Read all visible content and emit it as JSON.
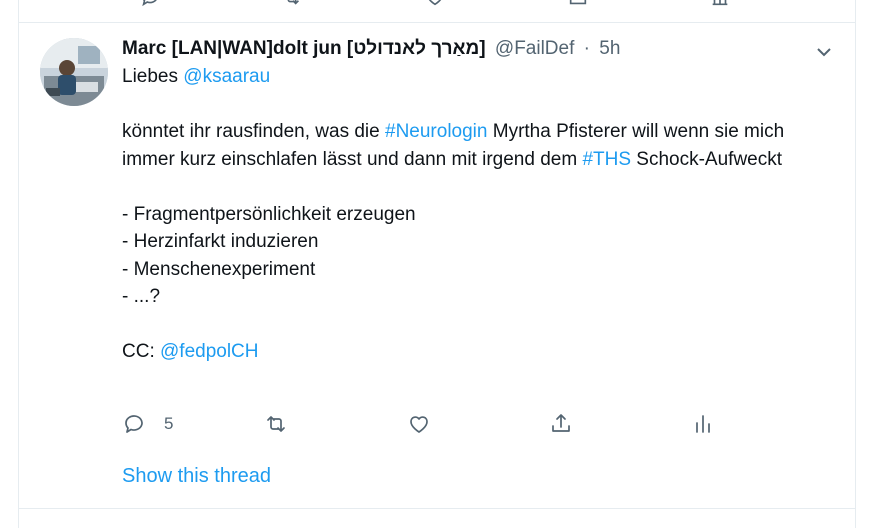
{
  "previous_tweet": {
    "icons": [
      "reply-icon",
      "retweet-icon",
      "like-icon",
      "share-icon",
      "analytics-icon"
    ]
  },
  "tweet": {
    "author_name": "Marc [LAN|WAN]dolt jun [מאַרך לאנדולט]",
    "author_handle": "@FailDef",
    "separator": "·",
    "time": "5h",
    "body": {
      "greeting": "Liebes ",
      "mention_1": "@ksaarau",
      "p2_a": "könntet ihr rausfinden, was die ",
      "hashtag_1": "#Neurologin",
      "p2_b": " Myrtha Pfisterer will wenn sie mich immer kurz einschlafen lässt und dann mit irgend dem ",
      "hashtag_2": "#THS",
      "p2_c": " Schock-Aufweckt",
      "list": [
        "- Fragmentpersönlichkeit erzeugen",
        "- Herzinfarkt induzieren",
        "- Menschenexperiment",
        "- ...?"
      ],
      "cc_label": "CC: ",
      "mention_2": "@fedpolCH"
    },
    "actions": {
      "reply_count": "5",
      "retweet_count": "",
      "like_count": ""
    },
    "show_thread": "Show this thread"
  },
  "colors": {
    "link": "#1d9bf0",
    "secondary_text": "#536471",
    "divider": "#e6ecf0"
  }
}
